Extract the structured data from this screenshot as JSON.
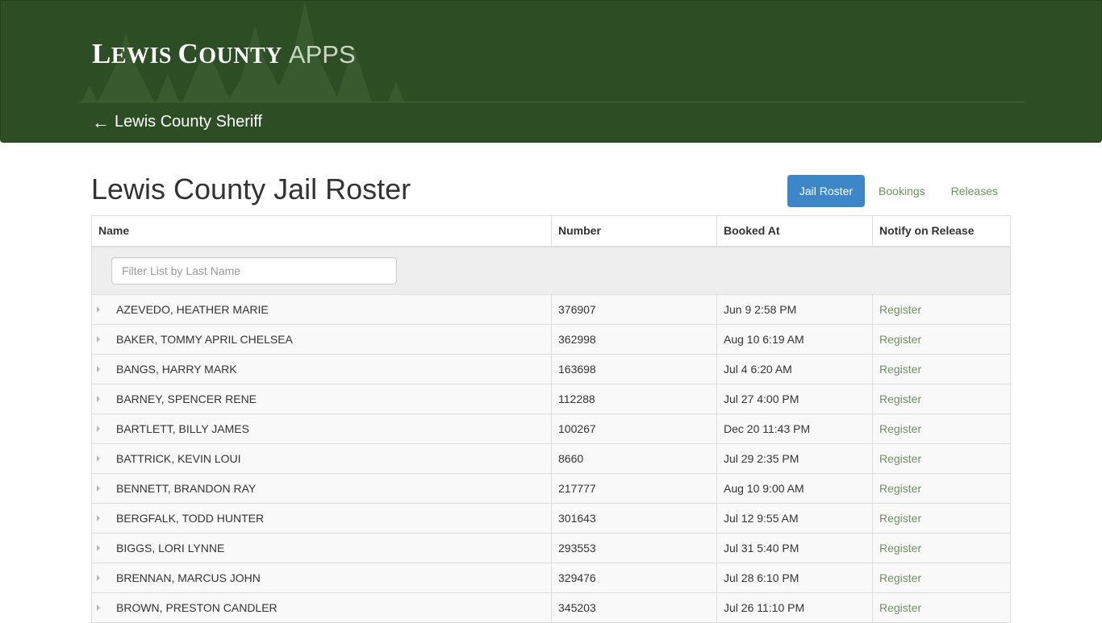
{
  "header": {
    "brand_first_initial": "L",
    "brand_first_rest": "EWIS",
    "brand_second_initial": "C",
    "brand_second_rest": "OUNTY",
    "brand_apps": "APPS",
    "back_arrow": "←",
    "back_link_label": "Lewis County Sheriff",
    "background_color": "#2d4e24"
  },
  "page": {
    "title": "Lewis County Jail Roster"
  },
  "nav": {
    "tabs": [
      {
        "label": "Jail Roster",
        "active": true
      },
      {
        "label": "Bookings",
        "active": false
      },
      {
        "label": "Releases",
        "active": false
      }
    ],
    "active_color": "#3d87c9",
    "link_color": "#6f9061"
  },
  "table": {
    "columns": [
      "Name",
      "Number",
      "Booked At",
      "Notify on Release"
    ],
    "filter_placeholder": "Filter List by Last Name",
    "filter_value": "",
    "rows": [
      {
        "name": "AZEVEDO, HEATHER MARIE",
        "number": "376907",
        "booked_at": "Jun 9 2:58 PM",
        "action": "Register"
      },
      {
        "name": "BAKER, TOMMY APRIL CHELSEA",
        "number": "362998",
        "booked_at": "Aug 10 6:19 AM",
        "action": "Register"
      },
      {
        "name": "BANGS, HARRY MARK",
        "number": "163698",
        "booked_at": "Jul 4 6:20 AM",
        "action": "Register"
      },
      {
        "name": "BARNEY, SPENCER RENE",
        "number": "112288",
        "booked_at": "Jul 27 4:00 PM",
        "action": "Register"
      },
      {
        "name": "BARTLETT, BILLY JAMES",
        "number": "100267",
        "booked_at": "Dec 20 11:43 PM",
        "action": "Register"
      },
      {
        "name": "BATTRICK, KEVIN LOUI",
        "number": "8660",
        "booked_at": "Jul 29 2:35 PM",
        "action": "Register"
      },
      {
        "name": "BENNETT, BRANDON RAY",
        "number": "217777",
        "booked_at": "Aug 10 9:00 AM",
        "action": "Register"
      },
      {
        "name": "BERGFALK, TODD HUNTER",
        "number": "301643",
        "booked_at": "Jul 12 9:55 AM",
        "action": "Register"
      },
      {
        "name": "BIGGS, LORI LYNNE",
        "number": "293553",
        "booked_at": "Jul 31 5:40 PM",
        "action": "Register"
      },
      {
        "name": "BRENNAN, MARCUS JOHN",
        "number": "329476",
        "booked_at": "Jul 28 6:10 PM",
        "action": "Register"
      },
      {
        "name": "BROWN, PRESTON CANDLER",
        "number": "345203",
        "booked_at": "Jul 26 11:10 PM",
        "action": "Register"
      }
    ]
  }
}
